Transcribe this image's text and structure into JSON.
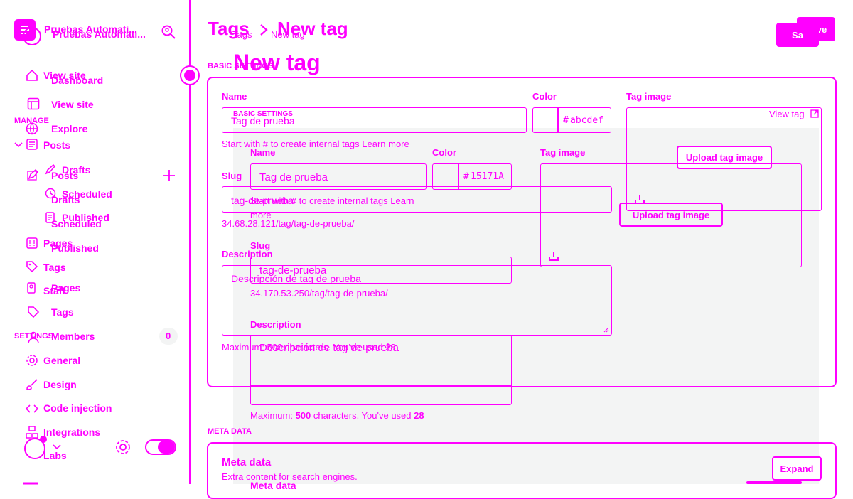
{
  "colors": {
    "accent": "#ff00ff",
    "panel": "#f3f4f4"
  },
  "sidebar": {
    "site_title": "Pruebas Automati...",
    "site_title_ghost": "Pruebas Automati...",
    "items_top": [
      {
        "label": "View site",
        "icon": "home-icon"
      },
      {
        "label": "Dashboard",
        "icon": "none"
      },
      {
        "label": "View site",
        "icon": "window-icon"
      },
      {
        "label": "Explore",
        "icon": "globe-icon"
      }
    ],
    "manage_label": "MANAGE",
    "posts_label": "Posts",
    "drafts_label": "Drafts",
    "scheduled_label": "Scheduled",
    "published_label": "Published",
    "posts_ghost": "Posts",
    "drafts_ghost": "Drafts",
    "scheduled_ghost": "Scheduled",
    "published_ghost": "Published",
    "pages_label": "Pages",
    "pages_ghost": "Pages",
    "tags_label": "Tags",
    "tags_ghost": "Tags",
    "staff_label": "Staff",
    "members_label": "Members",
    "members_count": "0",
    "settings_label": "SETTINGS",
    "settings_items": [
      {
        "label": "General",
        "icon": "gear-icon"
      },
      {
        "label": "Design",
        "icon": "brush-icon"
      },
      {
        "label": "Code injection",
        "icon": "code-icon"
      },
      {
        "label": "Integrations",
        "icon": "integrations-icon"
      },
      {
        "label": "Labs",
        "icon": "labs-icon"
      }
    ]
  },
  "header": {
    "breadcrumb_root": "Tags",
    "breadcrumb_current": "New tag",
    "breadcrumb_root_ghost": "Tags",
    "breadcrumb_current_ghost": "New tag",
    "title": "New tag",
    "save_label": "Save",
    "save_ghost": "Sa"
  },
  "basic": {
    "section_label": "BASIC SETTINGS",
    "section_label_ghost": "BASIC SETTINGS",
    "name_label": "Name",
    "name_value": "Tag de prueba",
    "color_label": "Color",
    "color_value": "abcdef",
    "color_hash": "#",
    "tag_image_label": "Tag image",
    "view_tag_label": "View tag",
    "upload_label": "Upload tag image",
    "hint": "Start with # to create internal tags Learn more",
    "slug_label": "Slug",
    "slug_value": "tag-de-prueba",
    "slug_url": "34.68.28.121/tag/tag-de-prueba/",
    "description_label": "Description",
    "description_value": "Descripción de tag de prueba",
    "max_text": "Maximum: 500 characters. You've used 28"
  },
  "ghost_form": {
    "name_label": "Name",
    "name_value": "Tag de prueba",
    "color_label": "Color",
    "color_hash": "#",
    "color_value": "15171A",
    "tag_image_label": "Tag image",
    "upload_label": "Upload tag image",
    "hint_line1": "Start with # to create internal tags Learn",
    "hint_line2": "more",
    "slug_label": "Slug",
    "slug_value": "tag-de-prueba",
    "slug_url": "34.170.53.250/tag/tag-de-prueba/",
    "description_label": "Description",
    "description_value": "Descripción de tag de prueba",
    "max_prefix": "Maximum: ",
    "max_number": "500",
    "max_middle": " characters. You've used ",
    "max_used": "28"
  },
  "meta": {
    "section_label": "META DATA",
    "title": "Meta data",
    "subtitle": "Extra content for search engines.",
    "expand_label": "Expand",
    "ghost_title": "Meta data"
  }
}
